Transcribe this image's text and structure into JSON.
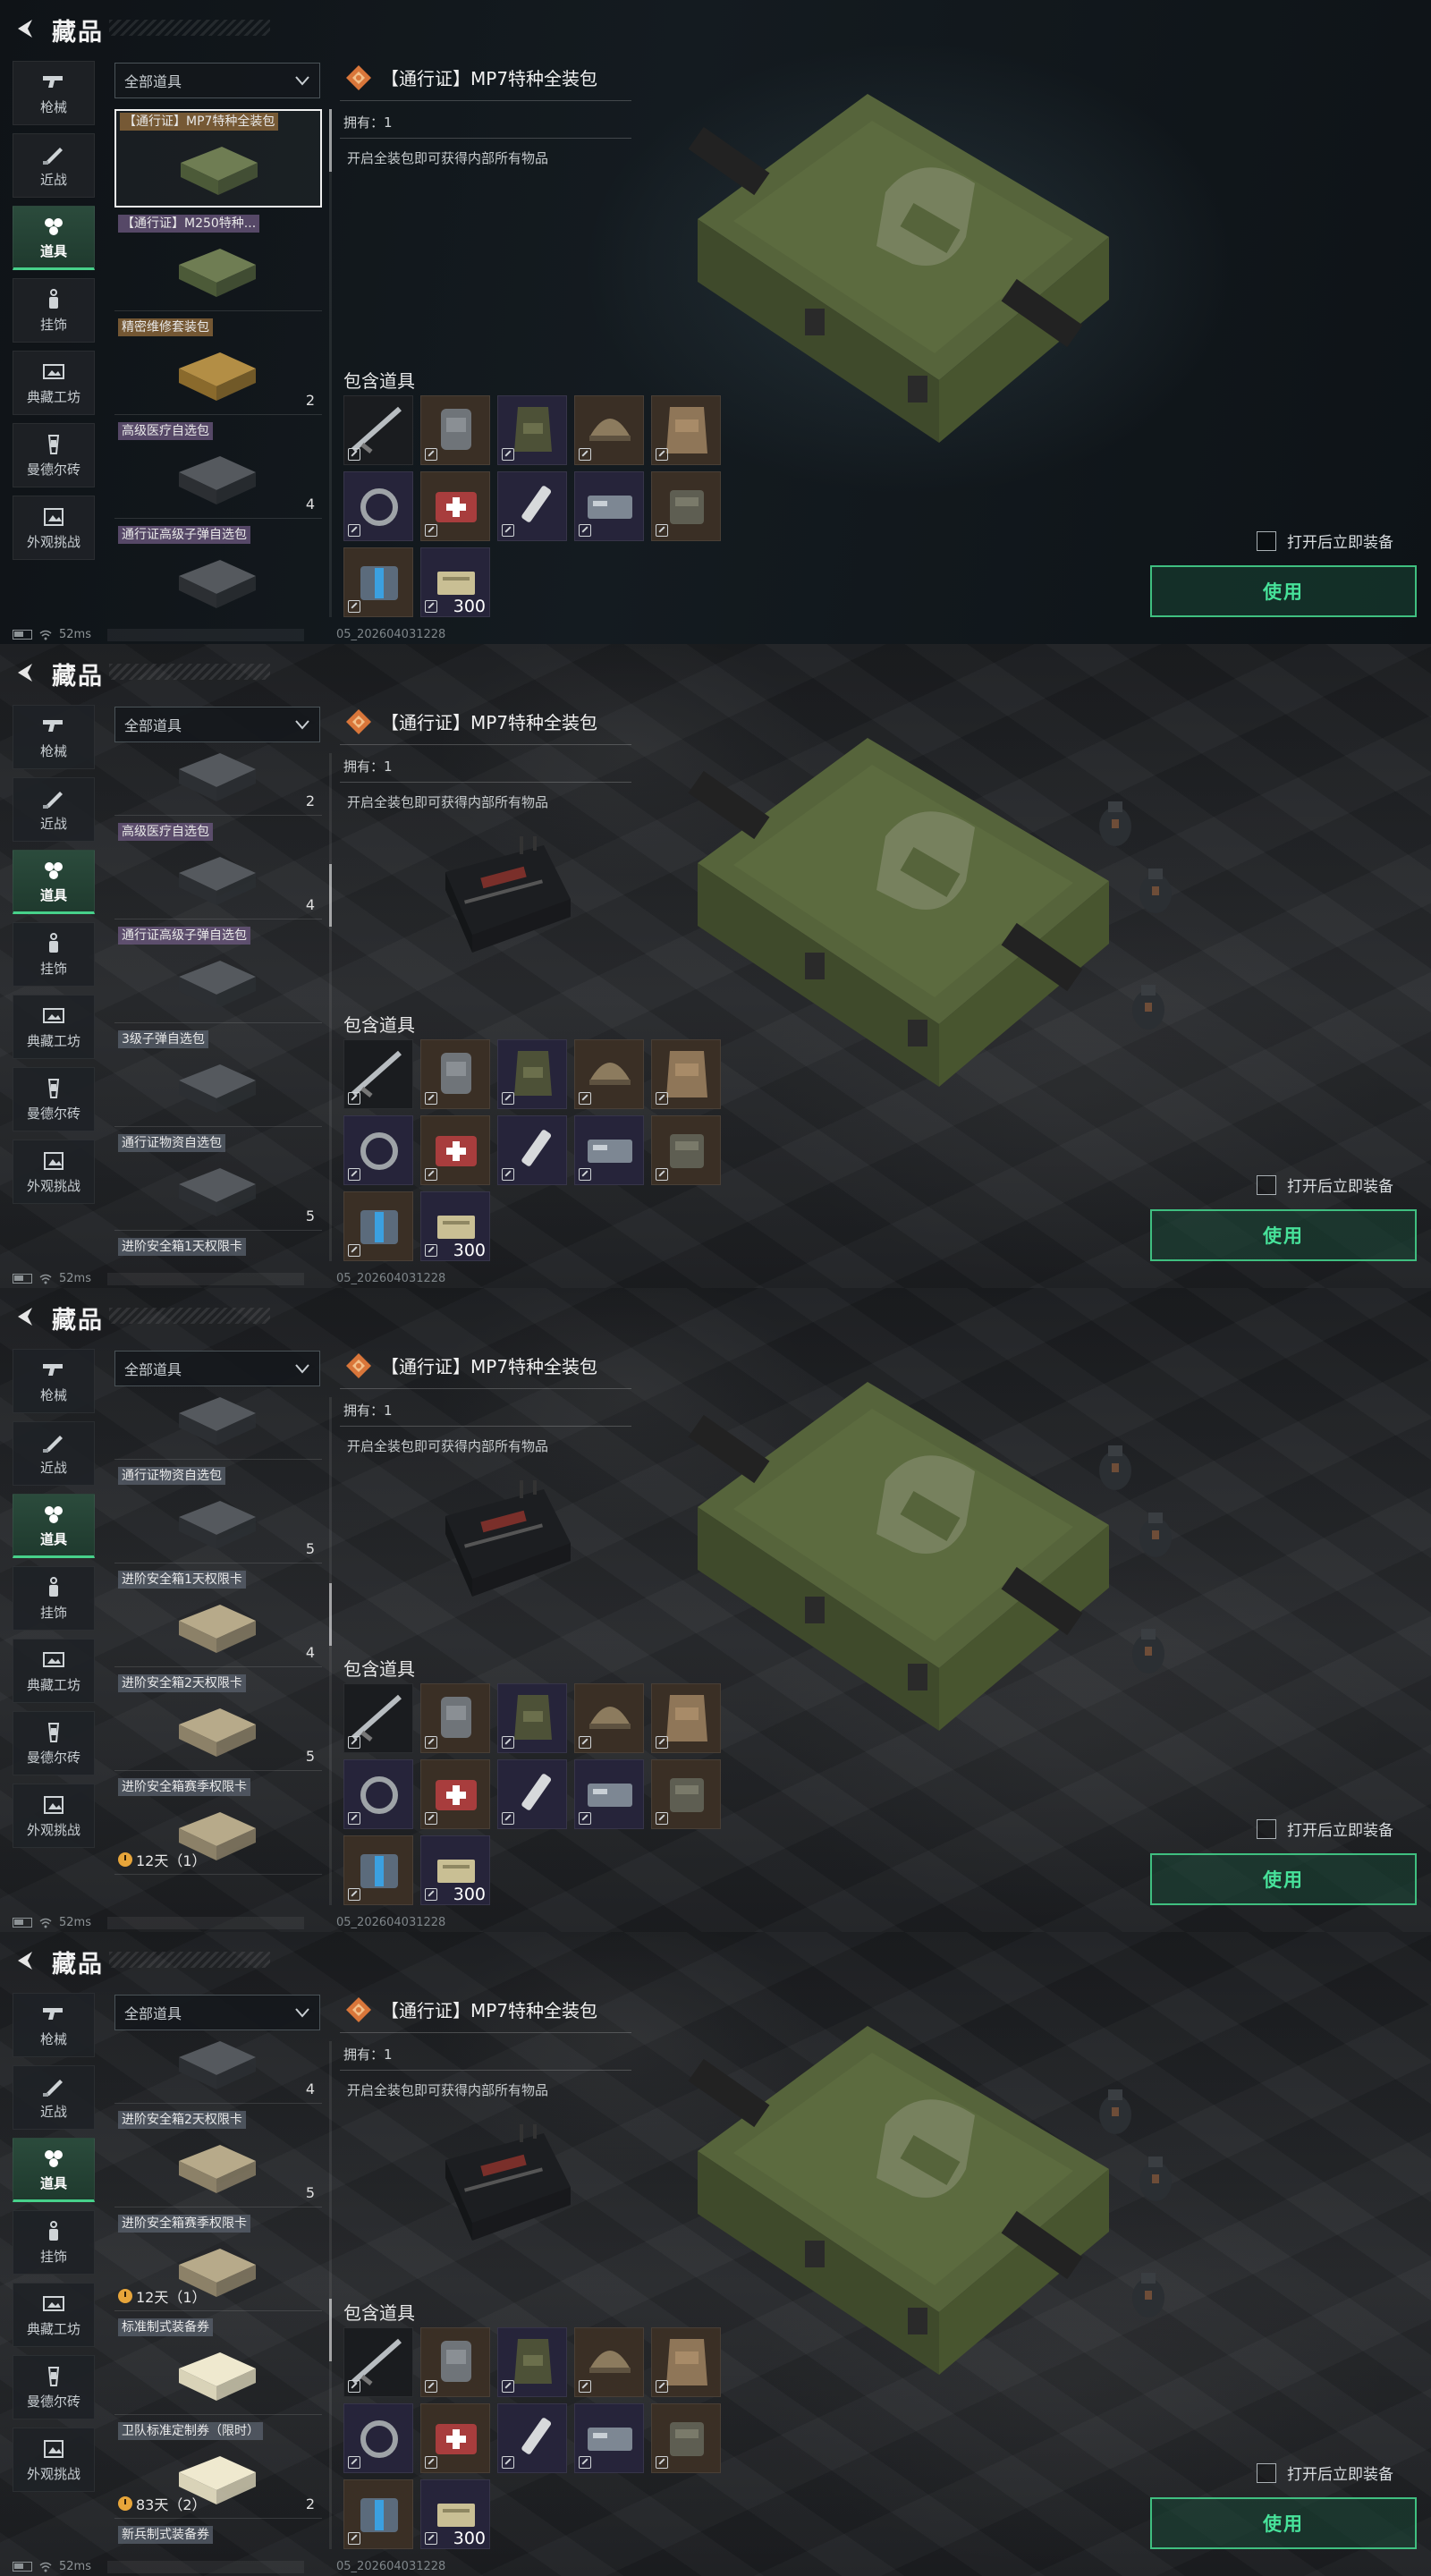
{
  "header": {
    "title": "藏品"
  },
  "categories": [
    {
      "label": "枪械",
      "icon": "gun-icon"
    },
    {
      "label": "近战",
      "icon": "knife-icon"
    },
    {
      "label": "道具",
      "icon": "items-icon"
    },
    {
      "label": "挂饰",
      "icon": "charm-icon"
    },
    {
      "label": "典藏工坊",
      "icon": "workshop-icon"
    },
    {
      "label": "曼德尔砖",
      "icon": "brick-icon"
    },
    {
      "label": "外观挑战",
      "icon": "challenge-icon"
    }
  ],
  "filter": {
    "label": "全部道具"
  },
  "detail": {
    "title": "【通行证】MP7特种全装包",
    "owned": "拥有：1",
    "description": "开启全装包即可获得内部所有物品",
    "contents_title": "包含道具",
    "grid_last_qty": "300"
  },
  "equip_after_open": "打开后立即装备",
  "use_button": "使用",
  "status": {
    "ping": "52ms",
    "build": "05_202604031228"
  },
  "frames": [
    {
      "items": [
        {
          "name": "【通行证】MP7特种全装包",
          "count": "",
          "timer": "",
          "selected": true
        },
        {
          "name": "【通行证】M250特种...",
          "count": "",
          "timer": ""
        },
        {
          "name": "精密维修套装包",
          "count": "2",
          "timer": ""
        },
        {
          "name": "高级医疗自选包",
          "count": "4",
          "timer": ""
        },
        {
          "name": "通行证高级子弹自选包",
          "count": "",
          "timer": ""
        }
      ]
    },
    {
      "items": [
        {
          "name": "",
          "count": "2",
          "timer": ""
        },
        {
          "name": "高级医疗自选包",
          "count": "4",
          "timer": ""
        },
        {
          "name": "通行证高级子弹自选包",
          "count": "",
          "timer": ""
        },
        {
          "name": "3级子弹自选包",
          "count": "",
          "timer": ""
        },
        {
          "name": "通行证物资自选包",
          "count": "5",
          "timer": ""
        },
        {
          "name": "进阶安全箱1天权限卡",
          "count": "",
          "timer": ""
        }
      ]
    },
    {
      "items": [
        {
          "name": "3级子弹自选包",
          "count": "",
          "timer": ""
        },
        {
          "name": "通行证物资自选包",
          "count": "5",
          "timer": ""
        },
        {
          "name": "进阶安全箱1天权限卡",
          "count": "4",
          "timer": ""
        },
        {
          "name": "进阶安全箱2天权限卡",
          "count": "5",
          "timer": ""
        },
        {
          "name": "进阶安全箱赛季权限卡",
          "count": "",
          "timer": "12天（1）"
        }
      ]
    },
    {
      "items": [
        {
          "name": "",
          "count": "4",
          "timer": ""
        },
        {
          "name": "进阶安全箱2天权限卡",
          "count": "5",
          "timer": ""
        },
        {
          "name": "进阶安全箱赛季权限卡",
          "count": "",
          "timer": "12天（1）"
        },
        {
          "name": "标准制式装备券",
          "count": "",
          "timer": ""
        },
        {
          "name": "卫队标准定制券（限时）",
          "count": "2",
          "timer": "83天（2）"
        },
        {
          "name": "新兵制式装备券",
          "count": "",
          "timer": ""
        }
      ]
    }
  ],
  "grid_items": [
    {
      "icon": "rifle-icon",
      "tone": "dark"
    },
    {
      "icon": "backpack-icon",
      "tone": "brown"
    },
    {
      "icon": "vest-icon",
      "tone": "purple"
    },
    {
      "icon": "helmet-icon",
      "tone": "brown"
    },
    {
      "icon": "armor-icon",
      "tone": "brown"
    },
    {
      "icon": "sling-icon",
      "tone": "purple"
    },
    {
      "icon": "medkit-icon",
      "tone": "brown"
    },
    {
      "icon": "syringe-icon",
      "tone": "purple"
    },
    {
      "icon": "card-icon",
      "tone": "purple"
    },
    {
      "icon": "pouch-icon",
      "tone": "brown"
    },
    {
      "icon": "kit-icon",
      "tone": "brown"
    },
    {
      "icon": "ammo-icon",
      "tone": "purple"
    }
  ],
  "colors": {
    "accent": "#47e29a",
    "active_tab": "#2b4b3c",
    "brown_cell": "#3a2f25",
    "purple_cell": "#26243a"
  }
}
